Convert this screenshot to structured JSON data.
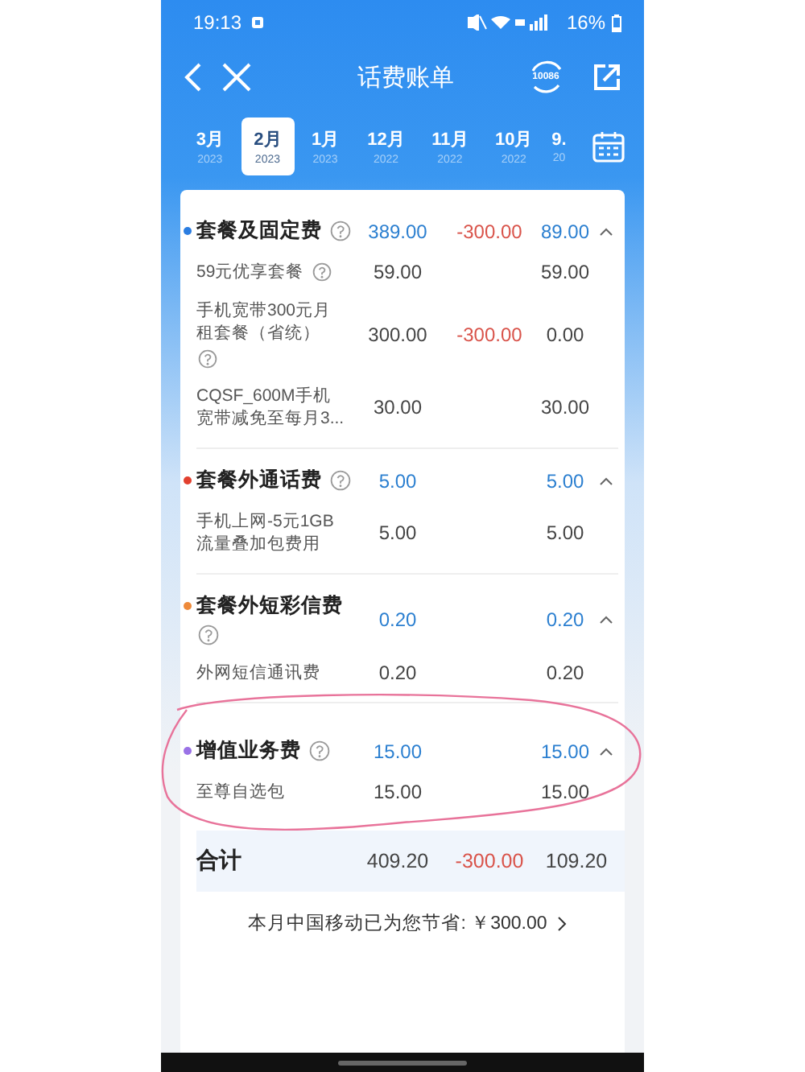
{
  "status_bar": {
    "time": "19:13",
    "battery": "16%"
  },
  "header": {
    "title": "话费账单",
    "service_label": "10086"
  },
  "months": [
    {
      "month": "3月",
      "year": "2023",
      "selected": false
    },
    {
      "month": "2月",
      "year": "2023",
      "selected": true
    },
    {
      "month": "1月",
      "year": "2023",
      "selected": false
    },
    {
      "month": "12月",
      "year": "2022",
      "selected": false
    },
    {
      "month": "11月",
      "year": "2022",
      "selected": false
    },
    {
      "month": "10月",
      "year": "2022",
      "selected": false
    },
    {
      "month": "9.",
      "year": "20",
      "selected": false
    }
  ],
  "sections": [
    {
      "name": "套餐及固定费",
      "color": "#2a7de1",
      "help": true,
      "amount": "389.00",
      "discount": "-300.00",
      "total": "89.00",
      "expanded": true,
      "items": [
        {
          "name": "59元优享套餐",
          "help": true,
          "amount": "59.00",
          "total": "59.00"
        },
        {
          "name": "手机宽带300元月租套餐（省统）",
          "help": true,
          "amount": "300.00",
          "discount": "-300.00",
          "total": "0.00"
        },
        {
          "name": "CQSF_600M手机宽带减免至每月3...",
          "help": false,
          "amount": "30.00",
          "total": "30.00"
        }
      ]
    },
    {
      "name": "套餐外通话费",
      "color": "#e2402f",
      "help": true,
      "amount": "5.00",
      "total": "5.00",
      "expanded": true,
      "items": [
        {
          "name": "手机上网-5元1GB流量叠加包费用",
          "help": false,
          "amount": "5.00",
          "total": "5.00"
        }
      ]
    },
    {
      "name": "套餐外短彩信费",
      "color": "#ee8a3a",
      "help": true,
      "amount": "0.20",
      "total": "0.20",
      "expanded": true,
      "items": [
        {
          "name": "外网短信通讯费",
          "help": false,
          "amount": "0.20",
          "total": "0.20"
        }
      ]
    },
    {
      "name": "增值业务费",
      "color": "#9a72e6",
      "help": true,
      "amount": "15.00",
      "total": "15.00",
      "expanded": true,
      "items": [
        {
          "name": "至尊自选包",
          "help": false,
          "amount": "15.00",
          "total": "15.00"
        }
      ]
    }
  ],
  "total_row": {
    "label": "合计",
    "amount": "409.20",
    "discount": "-300.00",
    "total": "109.20"
  },
  "savings_note": "本月中国移动已为您节省: ￥300.00"
}
